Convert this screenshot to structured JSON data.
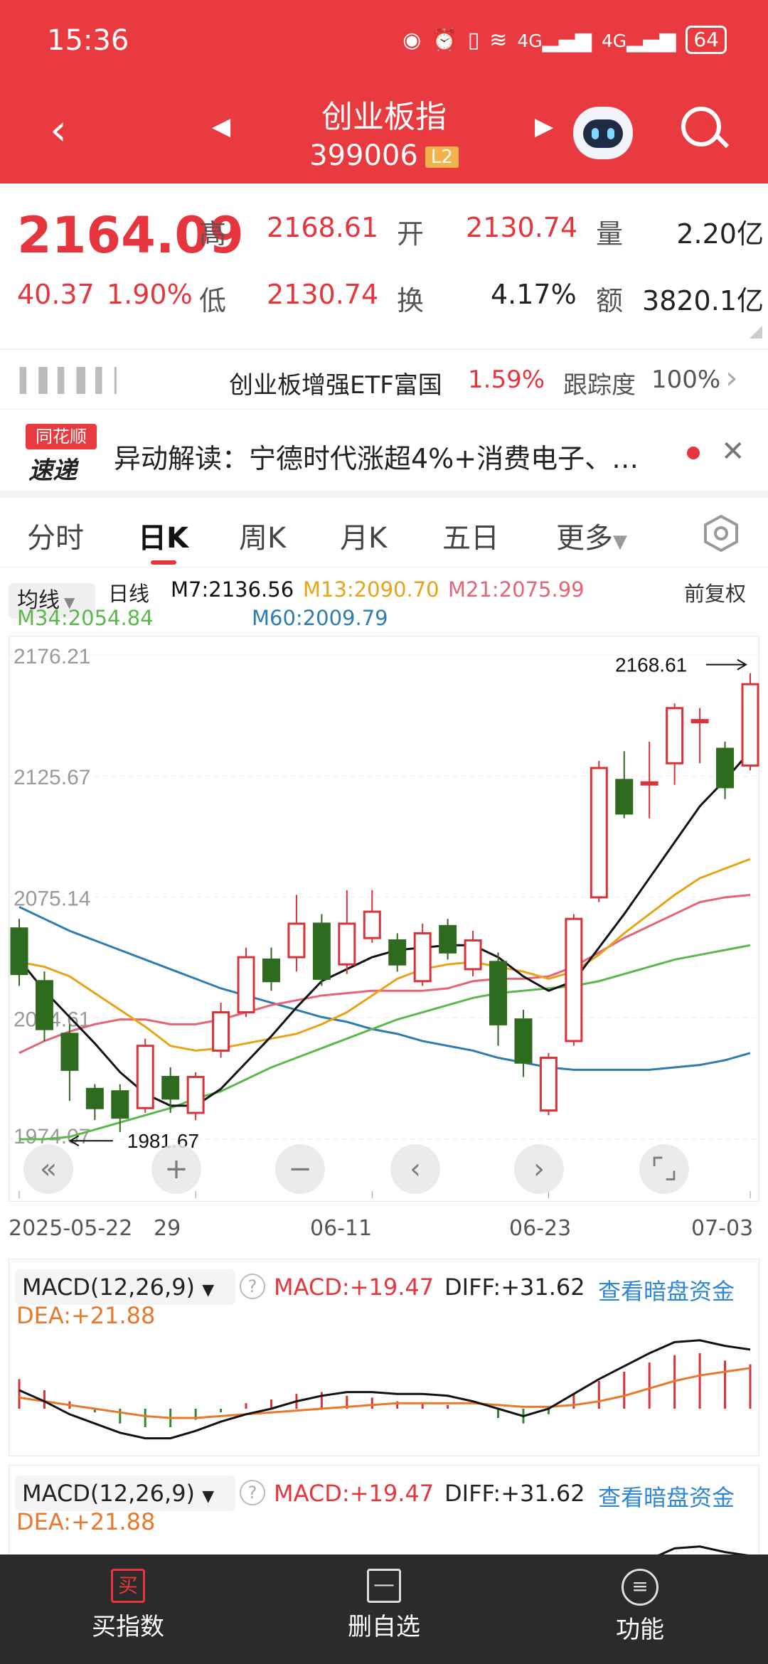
{
  "status": {
    "time": "15:36",
    "signal1": "4G",
    "signal2": "4G",
    "battery": "64"
  },
  "nav": {
    "title": "创业板指",
    "code": "399006",
    "level": "L2"
  },
  "quote": {
    "price": "2164.09",
    "change": "40.37",
    "change_pct": "1.90%",
    "high_label": "高",
    "high": "2168.61",
    "open_label": "开",
    "open": "2130.74",
    "volume_label": "量",
    "volume": "2.20亿",
    "low_label": "低",
    "low": "2130.74",
    "turnover_label": "换",
    "turnover": "4.17%",
    "amount_label": "额",
    "amount": "3820.1亿"
  },
  "etf": {
    "name": "创业板增强ETF富国",
    "change": "1.59%",
    "track_label": "跟踪度",
    "track": "100%"
  },
  "news": {
    "logo_line1": "同花顺",
    "logo_line2": "速递",
    "text": "异动解读：宁德时代涨超4%+消费电子、…"
  },
  "tabs": [
    "分时",
    "日K",
    "周K",
    "月K",
    "五日",
    "更多"
  ],
  "ma_legend": {
    "avg_btn": "均线",
    "kind": "日线",
    "m7": "M7:2136.56",
    "m13": "M13:2090.70",
    "m21": "M21:2075.99",
    "m34": "M34:2054.84",
    "m60": "M60:2009.79",
    "adjust": "前复权"
  },
  "colors": {
    "up": "#d8323a",
    "down": "#2e6b1f",
    "m7": "#111111",
    "m13": "#e8a317",
    "m21": "#e56477",
    "m34": "#5cb84c",
    "m60": "#2f7db0"
  },
  "chart_data": {
    "type": "candlestick",
    "y_ticks": [
      "2176.21",
      "2125.67",
      "2075.14",
      "2024.61",
      "1974.07"
    ],
    "ylim": [
      1974.07,
      2176.21
    ],
    "x_ticks": [
      "2025-05-22",
      "29",
      "06-11",
      "06-23",
      "07-03"
    ],
    "high_marker": "2168.61",
    "low_marker": "1981.67",
    "candles": [
      {
        "o": 2062,
        "c": 2043,
        "h": 2066,
        "l": 2038
      },
      {
        "o": 2040,
        "c": 2020,
        "h": 2044,
        "l": 2015
      },
      {
        "o": 2018,
        "c": 2003,
        "h": 2022,
        "l": 1990
      },
      {
        "o": 1995,
        "c": 1987,
        "h": 1997,
        "l": 1982
      },
      {
        "o": 1994,
        "c": 1983,
        "h": 1997,
        "l": 1977
      },
      {
        "o": 1987,
        "c": 2013,
        "h": 2016,
        "l": 1985
      },
      {
        "o": 2000,
        "c": 1991,
        "h": 2004,
        "l": 1985
      },
      {
        "o": 1985,
        "c": 2000,
        "h": 2002,
        "l": 1982
      },
      {
        "o": 2011,
        "c": 2027,
        "h": 2031,
        "l": 2008
      },
      {
        "o": 2027,
        "c": 2050,
        "h": 2054,
        "l": 2025
      },
      {
        "o": 2049,
        "c": 2040,
        "h": 2054,
        "l": 2036
      },
      {
        "o": 2050,
        "c": 2064,
        "h": 2076,
        "l": 2044
      },
      {
        "o": 2064,
        "c": 2041,
        "h": 2068,
        "l": 2038
      },
      {
        "o": 2047,
        "c": 2064,
        "h": 2078,
        "l": 2043
      },
      {
        "o": 2058,
        "c": 2069,
        "h": 2078,
        "l": 2056
      },
      {
        "o": 2057,
        "c": 2047,
        "h": 2060,
        "l": 2044
      },
      {
        "o": 2040,
        "c": 2060,
        "h": 2064,
        "l": 2038
      },
      {
        "o": 2063,
        "c": 2052,
        "h": 2066,
        "l": 2049
      },
      {
        "o": 2045,
        "c": 2057,
        "h": 2061,
        "l": 2042
      },
      {
        "o": 2048,
        "c": 2022,
        "h": 2052,
        "l": 2013
      },
      {
        "o": 2024,
        "c": 2006,
        "h": 2028,
        "l": 2000
      },
      {
        "o": 1986,
        "c": 2008,
        "h": 2010,
        "l": 1984
      },
      {
        "o": 2015,
        "c": 2066,
        "h": 2068,
        "l": 2013
      },
      {
        "o": 2075,
        "c": 2129,
        "h": 2132,
        "l": 2073
      },
      {
        "o": 2124,
        "c": 2110,
        "h": 2136,
        "l": 2108
      },
      {
        "o": 2123,
        "c": 2123,
        "h": 2140,
        "l": 2108
      },
      {
        "o": 2131,
        "c": 2154,
        "h": 2156,
        "l": 2122
      },
      {
        "o": 2149,
        "c": 2149,
        "h": 2154,
        "l": 2131
      },
      {
        "o": 2137,
        "c": 2121,
        "h": 2140,
        "l": 2116
      },
      {
        "o": 2130,
        "c": 2164,
        "h": 2168.61,
        "l": 2128
      }
    ],
    "ma": {
      "m7": [
        2049,
        2036,
        2025,
        2014,
        2002,
        1993,
        1988,
        1988,
        1995,
        2006,
        2017,
        2029,
        2040,
        2045,
        2050,
        2053,
        2054,
        2055,
        2055,
        2050,
        2042,
        2036,
        2040,
        2054,
        2068,
        2083,
        2098,
        2113,
        2124,
        2136
      ],
      "m13": [
        2048,
        2046,
        2042,
        2035,
        2028,
        2021,
        2013,
        2011,
        2012,
        2014,
        2016,
        2018,
        2022,
        2027,
        2034,
        2041,
        2045,
        2047,
        2048,
        2046,
        2044,
        2041,
        2044,
        2051,
        2060,
        2068,
        2076,
        2083,
        2087,
        2091
      ],
      "m21": [
        2010,
        2015,
        2019,
        2022,
        2024,
        2024,
        2022,
        2022,
        2024,
        2027,
        2030,
        2032,
        2034,
        2035,
        2036,
        2036,
        2036,
        2037,
        2040,
        2041,
        2041,
        2042,
        2046,
        2052,
        2058,
        2063,
        2068,
        2073,
        2075,
        2076
      ],
      "m34": [
        1974,
        1974,
        1975,
        1978,
        1981,
        1984,
        1987,
        1991,
        1994,
        1999,
        2004,
        2008,
        2012,
        2016,
        2020,
        2024,
        2027,
        2030,
        2033,
        2035,
        2036,
        2037,
        2038,
        2040,
        2043,
        2046,
        2049,
        2051,
        2053,
        2055
      ],
      "m60": [
        2071,
        2066,
        2061,
        2057,
        2053,
        2049,
        2045,
        2041,
        2037,
        2034,
        2031,
        2028,
        2025,
        2023,
        2020,
        2018,
        2015,
        2013,
        2011,
        2008,
        2006,
        2004,
        2003,
        2003,
        2003,
        2003,
        2004,
        2005,
        2007,
        2010
      ]
    }
  },
  "macd": {
    "name": "MACD(12,26,9)",
    "macd": "MACD:+19.47",
    "diff": "DIFF:+31.62",
    "link": "查看暗盘资金",
    "dea": "DEA:+21.88",
    "hist": [
      16,
      10,
      4,
      -2,
      -8,
      -10,
      -10,
      -6,
      -2,
      3,
      5,
      8,
      9,
      7,
      6,
      4,
      3,
      2,
      0,
      -5,
      -8,
      -3,
      8,
      15,
      20,
      25,
      29,
      30,
      26,
      24
    ],
    "diff_line": [
      10,
      4,
      -3,
      -8,
      -13,
      -16,
      -16,
      -12,
      -7,
      -3,
      0,
      4,
      7,
      9,
      9,
      8,
      8,
      7,
      4,
      0,
      -4,
      0,
      8,
      16,
      23,
      30,
      36,
      37,
      34,
      32
    ],
    "dea_line": [
      6,
      4,
      2,
      0,
      -2,
      -4,
      -5,
      -5,
      -4,
      -3,
      -2,
      -1,
      0,
      1,
      2,
      3,
      3,
      3,
      3,
      2,
      1,
      1,
      2,
      4,
      7,
      11,
      15,
      18,
      20,
      22
    ]
  },
  "bottom": {
    "buy": "买指数",
    "buy_icon": "买",
    "del": "删自选",
    "func": "功能"
  }
}
